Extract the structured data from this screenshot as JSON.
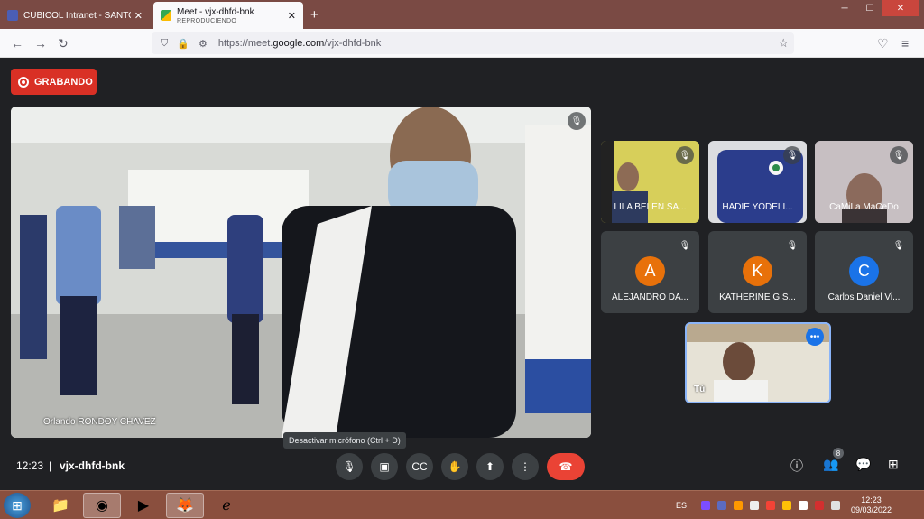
{
  "browser": {
    "tabs": [
      {
        "title": "CUBICOL Intranet - SANTO DOMI",
        "subtitle": ""
      },
      {
        "title": "Meet - vjx-dhfd-bnk",
        "subtitle": "REPRODUCIENDO"
      }
    ],
    "url_prefix": "https://meet.",
    "url_domain": "google.com",
    "url_path": "/vjx-dhfd-bnk"
  },
  "meet": {
    "recording_label": "GRABANDO",
    "main_speaker": "Orlando RONDOY CHAVEZ",
    "participants": [
      {
        "name": "LILA BELEN SA...",
        "type": "video"
      },
      {
        "name": "HADIE YODELI...",
        "type": "video"
      },
      {
        "name": "CaMiLa MaCeDo",
        "type": "video"
      },
      {
        "name": "ALEJANDRO DA...",
        "initial": "A",
        "color": "#e8710a"
      },
      {
        "name": "KATHERINE GIS...",
        "initial": "K",
        "color": "#e8710a"
      },
      {
        "name": "Carlos Daniel Vi...",
        "initial": "C",
        "color": "#1a73e8"
      }
    ],
    "self_label": "Tú",
    "tooltip": "Desactivar micrófono (Ctrl + D)",
    "time": "12:23",
    "separator": "|",
    "meeting_code": "vjx-dhfd-bnk",
    "people_count": "8"
  },
  "taskbar": {
    "language": "ES",
    "time": "12:23",
    "date": "09/03/2022"
  }
}
